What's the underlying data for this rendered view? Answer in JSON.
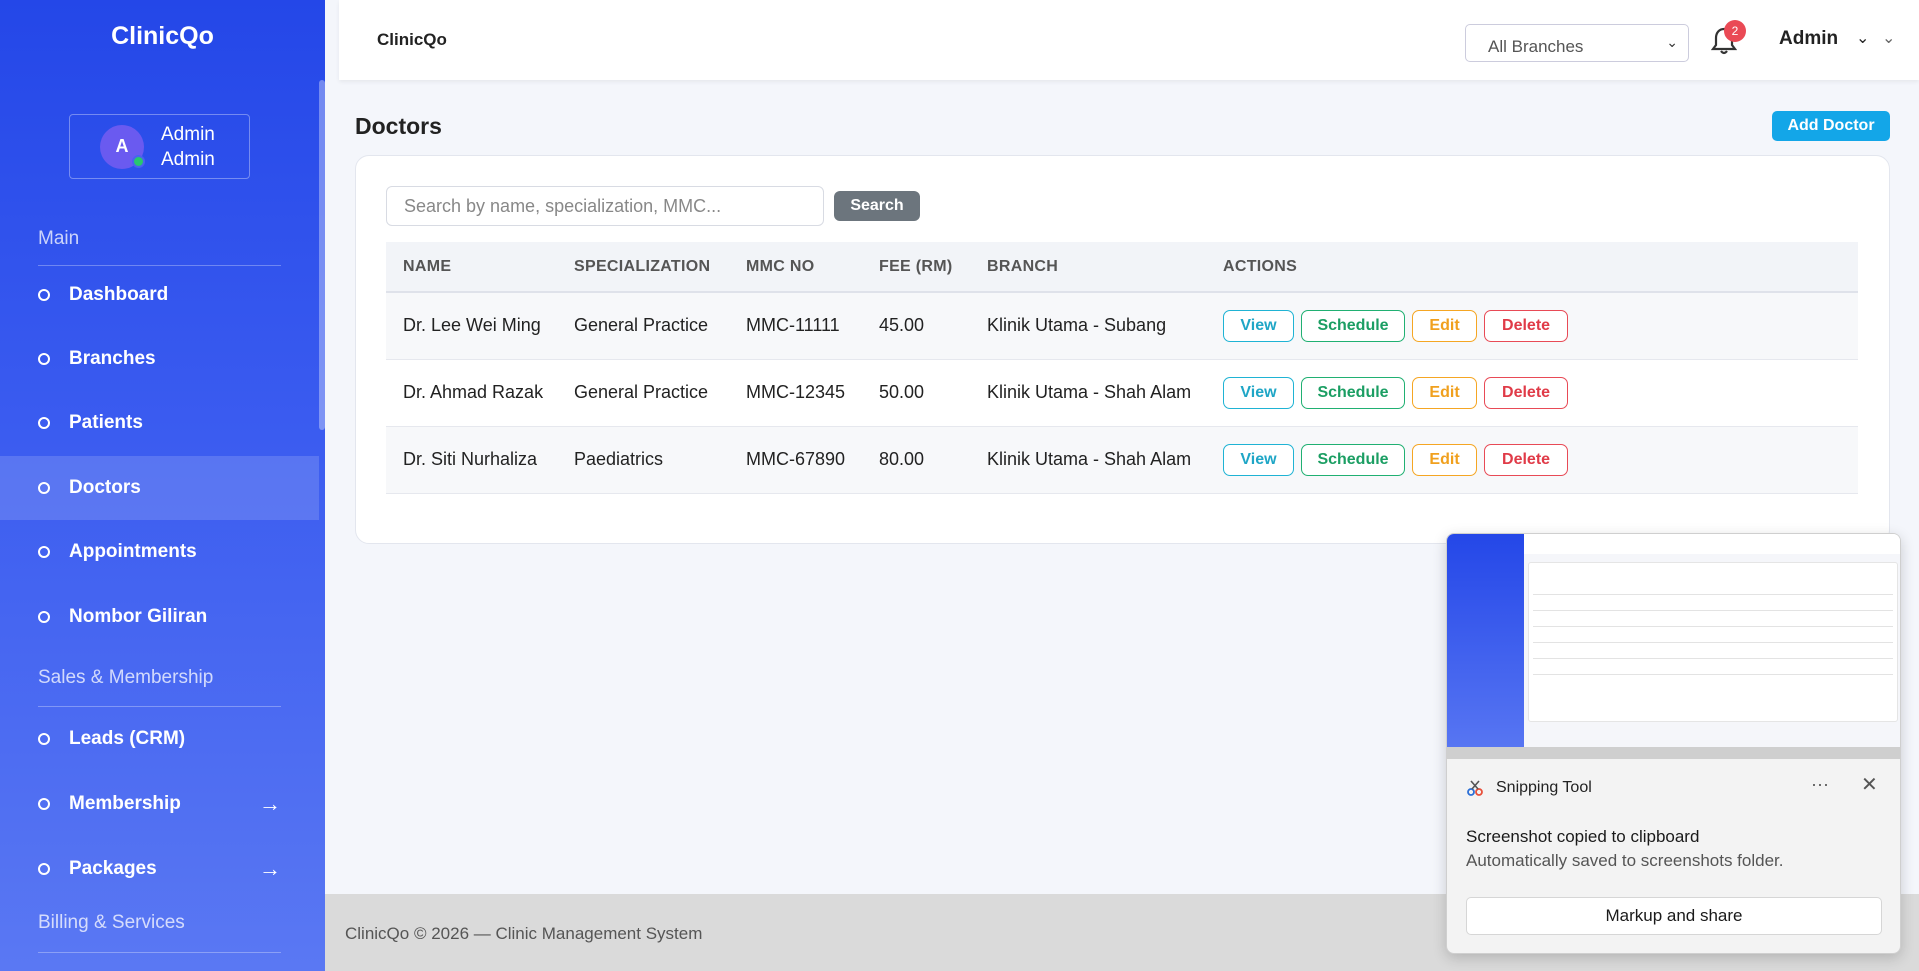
{
  "brand": "ClinicQo",
  "user": {
    "initial": "A",
    "name": "Admin",
    "role": "Admin"
  },
  "sidebar": {
    "sections": [
      {
        "label": "Main"
      },
      {
        "label": "Sales & Membership"
      },
      {
        "label": "Billing & Services"
      }
    ],
    "items": [
      {
        "label": "Dashboard",
        "active": false
      },
      {
        "label": "Branches",
        "active": false
      },
      {
        "label": "Patients",
        "active": false
      },
      {
        "label": "Doctors",
        "active": true
      },
      {
        "label": "Appointments",
        "active": false
      },
      {
        "label": "Nombor Giliran",
        "active": false
      },
      {
        "label": "Leads (CRM)",
        "active": false
      },
      {
        "label": "Membership",
        "active": false,
        "has_arrow": true
      },
      {
        "label": "Packages",
        "active": false,
        "has_arrow": true
      }
    ],
    "arrow_icon": "arrow-right-icon"
  },
  "topbar": {
    "app_title": "ClinicQo",
    "branch_select": "All Branches",
    "notification_count": "2",
    "admin_label": "Admin"
  },
  "page": {
    "title": "Doctors",
    "add_button": "Add Doctor",
    "search_placeholder": "Search by name, specialization, MMC...",
    "search_button": "Search"
  },
  "table": {
    "headers": [
      "NAME",
      "SPECIALIZATION",
      "MMC NO",
      "FEE (RM)",
      "BRANCH",
      "ACTIONS"
    ],
    "rows": [
      {
        "name": "Dr. Lee Wei Ming",
        "specialization": "General Practice",
        "mmc": "MMC-11111",
        "fee": "45.00",
        "branch": "Klinik Utama - Subang"
      },
      {
        "name": "Dr. Ahmad Razak",
        "specialization": "General Practice",
        "mmc": "MMC-12345",
        "fee": "50.00",
        "branch": "Klinik Utama - Shah Alam"
      },
      {
        "name": "Dr. Siti Nurhaliza",
        "specialization": "Paediatrics",
        "mmc": "MMC-67890",
        "fee": "80.00",
        "branch": "Klinik Utama - Shah Alam"
      }
    ],
    "actions": {
      "view": "View",
      "schedule": "Schedule",
      "edit": "Edit",
      "delete": "Delete"
    }
  },
  "footer": {
    "text": "ClinicQo © 2026 — Clinic Management System"
  },
  "toast": {
    "app_name": "Snipping Tool",
    "title": "Screenshot copied to clipboard",
    "subtitle": "Automatically saved to screenshots folder.",
    "button": "Markup and share",
    "more": "···",
    "close": "✕"
  },
  "colors": {
    "sidebar_top": "#2447e8",
    "sidebar_bottom": "#5a78f3",
    "primary_button": "#13a6e8",
    "view": "#1fb3d4",
    "schedule": "#20b072",
    "edit": "#f5a623",
    "delete": "#e84a56",
    "badge": "#ea4a55"
  }
}
